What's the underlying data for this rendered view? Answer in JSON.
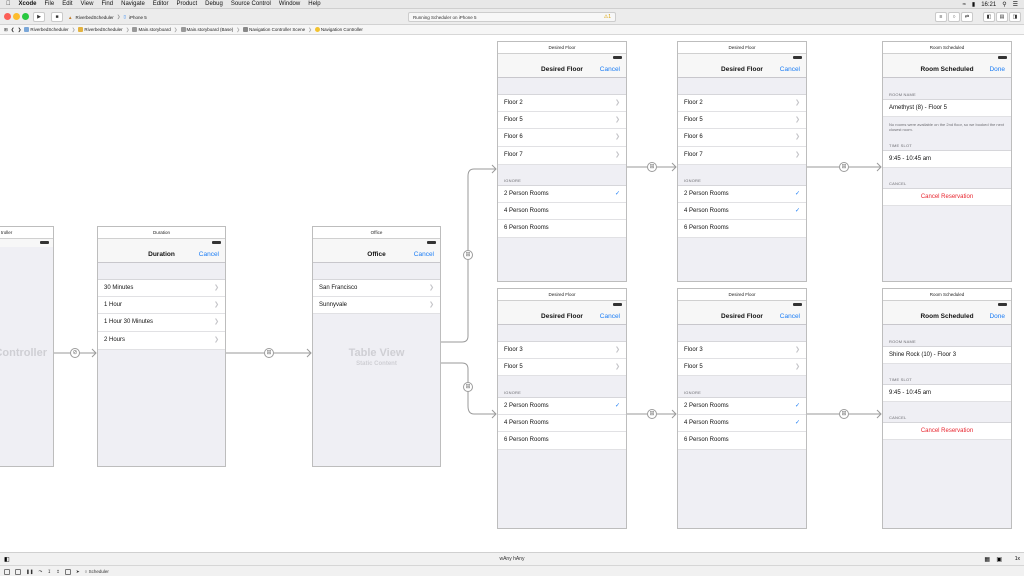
{
  "menubar": {
    "apple": "",
    "items": [
      "Xcode",
      "File",
      "Edit",
      "View",
      "Find",
      "Navigate",
      "Editor",
      "Product",
      "Debug",
      "Source Control",
      "Window",
      "Help"
    ],
    "clock": "16:21"
  },
  "toolbar": {
    "scheme": "RiverbedScheduler",
    "device": "iPhone 5",
    "status": "Running Scheduler on iPhone 5",
    "warning_count": "1"
  },
  "jumpbar": {
    "crumbs": [
      "RiverbedScheduler",
      "RiverbedScheduler",
      "Main.storyboard",
      "Main.storyboard (Base)",
      "Navigation Controller Scene",
      "Navigation Controller"
    ]
  },
  "scenes": {
    "navctrl": {
      "title": "troller",
      "watermark": "Controller"
    },
    "duration": {
      "title": "Duration",
      "nav_title": "Duration",
      "nav_button": "Cancel",
      "rows": [
        "30 Minutes",
        "1 Hour",
        "1 Hour 30 Minutes",
        "2 Hours"
      ]
    },
    "office": {
      "title": "Office",
      "nav_title": "Office",
      "nav_button": "Cancel",
      "rows": [
        "San Francisco",
        "Sunnyvale"
      ],
      "watermark": "Table View",
      "watermark_sub": "Static Content"
    },
    "floor1": {
      "title": "Desired Floor",
      "nav_title": "Desired Floor",
      "nav_button": "Cancel",
      "floors": [
        "Floor 2",
        "Floor 5",
        "Floor 6",
        "Floor 7"
      ],
      "ignore_header": "IGNORE",
      "ignore": [
        "2 Person Rooms",
        "4 Person Rooms",
        "6 Person Rooms"
      ]
    },
    "floor2": {
      "title": "Desired Floor",
      "nav_title": "Desired Floor",
      "nav_button": "Cancel",
      "floors": [
        "Floor 2",
        "Floor 5",
        "Floor 6",
        "Floor 7"
      ],
      "ignore_header": "IGNORE",
      "ignore": [
        "2 Person Rooms",
        "4 Person Rooms",
        "6 Person Rooms"
      ]
    },
    "floor3": {
      "title": "Desired Floor",
      "nav_title": "Desired Floor",
      "nav_button": "Cancel",
      "floors": [
        "Floor 3",
        "Floor 5"
      ],
      "ignore_header": "IGNORE",
      "ignore": [
        "2 Person Rooms",
        "4 Person Rooms",
        "6 Person Rooms"
      ]
    },
    "floor4": {
      "title": "Desired Floor",
      "nav_title": "Desired Floor",
      "nav_button": "Cancel",
      "floors": [
        "Floor 3",
        "Floor 5"
      ],
      "ignore_header": "IGNORE",
      "ignore": [
        "2 Person Rooms",
        "4 Person Rooms",
        "6 Person Rooms"
      ]
    },
    "room1": {
      "title": "Room Scheduled",
      "nav_title": "Room Scheduled",
      "nav_button": "Done",
      "room_header": "ROOM NAME",
      "room": "Amethyst (8) - Floor 5",
      "note": "No rooms were available on the 2nd floor, so we booked the next closest room.",
      "slot_header": "TIME SLOT",
      "slot": "9:45 - 10:45 am",
      "cancel_header": "CANCEL",
      "cancel": "Cancel Reservation"
    },
    "room2": {
      "title": "Room Scheduled",
      "nav_title": "Room Scheduled",
      "nav_button": "Done",
      "room_header": "ROOM NAME",
      "room": "Shine Rock (10) - Floor 3",
      "slot_header": "TIME SLOT",
      "slot": "9:45 - 10:45 am",
      "cancel_header": "CANCEL",
      "cancel": "Cancel Reservation"
    }
  },
  "bottombar": {
    "size_class": "wAny hAny",
    "zoom": "1x",
    "debug_target": "Scheduler"
  }
}
